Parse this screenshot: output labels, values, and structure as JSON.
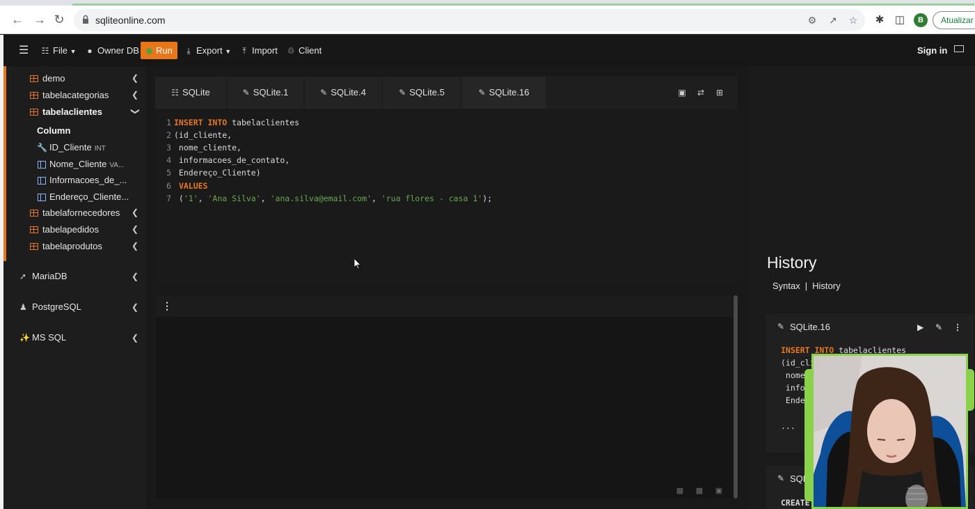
{
  "browser": {
    "url": "sqliteonline.com",
    "profile_initial": "B",
    "update_label": "Atualizar"
  },
  "appbar": {
    "file_label": "File",
    "owner_db_label": "Owner DB",
    "run_label": "Run",
    "export_label": "Export",
    "import_label": "Import",
    "client_label": "Client",
    "signin_label": "Sign in"
  },
  "sidebar": {
    "tables": [
      {
        "label": "demo"
      },
      {
        "label": "tabelacategorias"
      },
      {
        "label": "tabelaclientes"
      },
      {
        "label": "tabelafornecedores"
      },
      {
        "label": "tabelapedidos"
      },
      {
        "label": "tabelaprodutos"
      }
    ],
    "column_header": "Column",
    "columns": [
      {
        "label": "ID_Cliente",
        "type": "INT"
      },
      {
        "label": "Nome_Cliente",
        "type": "VA..."
      },
      {
        "label": "Informacoes_de_...",
        "type": ""
      },
      {
        "label": "Endereço_Cliente...",
        "type": ""
      }
    ],
    "databases": [
      {
        "label": "MariaDB"
      },
      {
        "label": "PostgreSQL"
      },
      {
        "label": "MS SQL"
      }
    ]
  },
  "editor": {
    "tabs": [
      {
        "label": "SQLite"
      },
      {
        "label": "SQLite.1"
      },
      {
        "label": "SQLite.4"
      },
      {
        "label": "SQLite.5"
      },
      {
        "label": "SQLite.16"
      }
    ],
    "lines": [
      {
        "n": "1"
      },
      {
        "n": "2"
      },
      {
        "n": "3"
      },
      {
        "n": "4"
      },
      {
        "n": "5"
      },
      {
        "n": "6"
      },
      {
        "n": "7"
      }
    ],
    "code": {
      "kw_insert": "INSERT",
      "kw_into": "INTO",
      "tbl": "tabelaclientes",
      "l2": "(id_cliente,",
      "l3": " nome_cliente,",
      "l4": " informacoes_de_contato,",
      "l5": " Endereço_Cliente)",
      "kw_values": "VALUES",
      "l7_open": " (",
      "v1": "'1'",
      "v2": "'Ana Silva'",
      "v3": "'ana.silva@email.com'",
      "v4": "'rua flores - casa 1'",
      "comma": ", ",
      "l7_close": ");"
    }
  },
  "history": {
    "title": "History",
    "tab_syntax": "Syntax",
    "tab_separator": "|",
    "tab_history": "History",
    "card1_title": "SQLite.16",
    "card1_code_l1_rest": "tabelaclientes",
    "card1_code_l2": "(id_cli",
    "card1_code_l3": " nome_c",
    "card1_code_l4": " inform",
    "card1_code_l5": " Endere",
    "card1_ellipsis": "...",
    "card2_title": "SQL",
    "card2_code": "CREATE"
  }
}
